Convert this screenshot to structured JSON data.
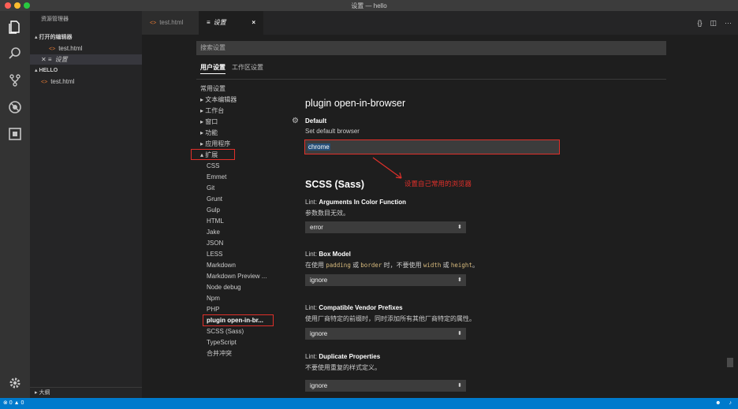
{
  "window": {
    "title": "设置 — hello"
  },
  "activity_bar": {
    "icons": [
      "files-icon",
      "search-icon",
      "source-control-icon",
      "debug-icon",
      "extensions-icon",
      "settings-gear-icon"
    ]
  },
  "sidebar": {
    "title": "资源管理器",
    "open_editors_label": "▴ 打开的编辑器",
    "open_editors": [
      {
        "name": "test.html"
      },
      {
        "name": "设置",
        "prefix": "✕ ≡"
      }
    ],
    "folder_label": "▴ HELLO",
    "files": [
      {
        "name": "test.html"
      }
    ],
    "outline_label": "▸ 大纲"
  },
  "tabs": [
    {
      "label": "test.html",
      "glyph": "<>"
    },
    {
      "label": "设置",
      "glyph": "≡",
      "close": "×"
    }
  ],
  "tab_actions": [
    "{}",
    "◫",
    "···"
  ],
  "settings_editor": {
    "search_placeholder": "搜索设置",
    "scope_tabs": [
      "用户设置",
      "工作区设置"
    ],
    "toc": [
      {
        "label": "常用设置",
        "level": 0
      },
      {
        "label": "▸ 文本编辑器",
        "level": 0
      },
      {
        "label": "▸ 工作台",
        "level": 0
      },
      {
        "label": "▸ 窗口",
        "level": 0
      },
      {
        "label": "▸ 功能",
        "level": 0
      },
      {
        "label": "▸ 应用程序",
        "level": 0
      },
      {
        "label": "▴ 扩展",
        "level": 0
      },
      {
        "label": "CSS",
        "level": 1
      },
      {
        "label": "Emmet",
        "level": 1
      },
      {
        "label": "Git",
        "level": 1
      },
      {
        "label": "Grunt",
        "level": 1
      },
      {
        "label": "Gulp",
        "level": 1
      },
      {
        "label": "HTML",
        "level": 1
      },
      {
        "label": "Jake",
        "level": 1
      },
      {
        "label": "JSON",
        "level": 1
      },
      {
        "label": "LESS",
        "level": 1
      },
      {
        "label": "Markdown",
        "level": 1
      },
      {
        "label": "Markdown Preview ...",
        "level": 1
      },
      {
        "label": "Node debug",
        "level": 1
      },
      {
        "label": "Npm",
        "level": 1
      },
      {
        "label": "PHP",
        "level": 1
      },
      {
        "label": "plugin open-in-br...",
        "level": 1
      },
      {
        "label": "SCSS (Sass)",
        "level": 1
      },
      {
        "label": "TypeScript",
        "level": 1
      },
      {
        "label": "合并冲突",
        "level": 1
      }
    ],
    "plugin_section": {
      "title": "plugin open-in-browser",
      "setting_name": "Default",
      "setting_desc": "Set default browser",
      "value": "chrome"
    },
    "annotation": "设置自己常用的浏览器",
    "scss_section": {
      "title": "SCSS (Sass)",
      "settings": [
        {
          "prefix": "Lint: ",
          "name": "Arguments In Color Function",
          "desc": "参数数目无效。",
          "value": "error"
        },
        {
          "prefix": "Lint: ",
          "name": "Box Model",
          "desc_parts": [
            "在使用 ",
            "padding",
            " 或 ",
            "border",
            " 时，不要使用 ",
            "width",
            " 或 ",
            "height",
            "。"
          ],
          "value": "ignore"
        },
        {
          "prefix": "Lint: ",
          "name": "Compatible Vendor Prefixes",
          "desc": "使用厂商特定的前缀时，同时添加所有其他厂商特定的属性。",
          "value": "ignore"
        },
        {
          "prefix": "Lint: ",
          "name": "Duplicate Properties",
          "desc": "不要使用重复的样式定义。",
          "value": "ignore"
        }
      ]
    }
  },
  "status_bar": {
    "problems": "⊗ 0 ▲ 0",
    "right_icons": [
      "smiley-icon",
      "bell-icon"
    ]
  },
  "colors": {
    "accent": "#007acc",
    "highlight_box": "#e0302a",
    "selection": "#264f78"
  }
}
